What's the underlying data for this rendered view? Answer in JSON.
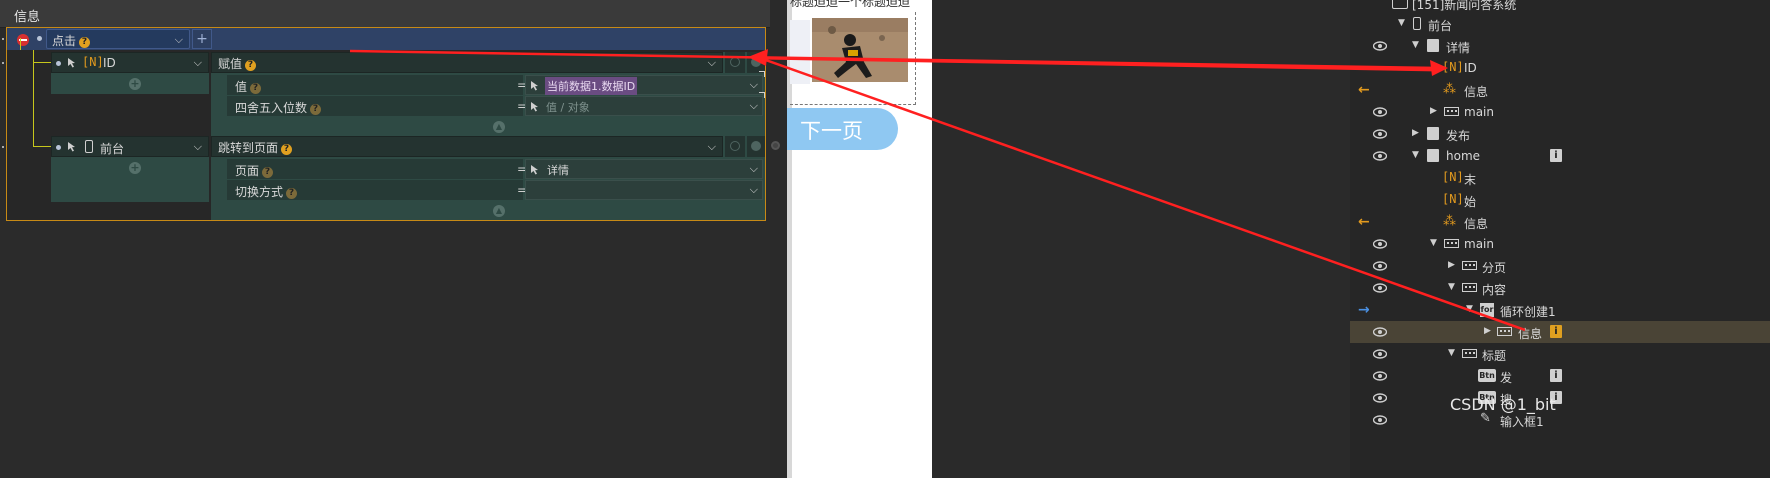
{
  "editor": {
    "title": "信息",
    "event_label": "点击",
    "actions": [
      {
        "target_label": "ID",
        "target_type": "[N]",
        "action_label": "赋值",
        "params": [
          {
            "name": "值",
            "value": "当前数据1.数据ID",
            "is_placeholder": false
          },
          {
            "name": "四舍五入位数",
            "value": "值 / 对象",
            "is_placeholder": true
          }
        ]
      },
      {
        "target_label": "前台",
        "action_label": "跳转到页面",
        "params": [
          {
            "name": "页面",
            "value": "详情",
            "is_placeholder": false
          },
          {
            "name": "切换方式",
            "value": "",
            "is_placeholder": false
          }
        ]
      }
    ],
    "equals": "="
  },
  "preview": {
    "top_text": "标题迫迫一个标题迫迫",
    "next_button": "下一页"
  },
  "tree": {
    "rows": [
      {
        "label": "[151]新闻问答系统",
        "indent": 60,
        "icon": "system-icon",
        "eye": false
      },
      {
        "label": "前台",
        "indent": 60,
        "icon": "phone-icon",
        "expanded": true,
        "eye": false
      },
      {
        "label": "详情",
        "indent": 78,
        "icon": "page-icon",
        "expanded": true,
        "eye": true
      },
      {
        "label": "ID",
        "indent": 96,
        "icon": "n-var-icon",
        "eye": false
      },
      {
        "label": "信息",
        "indent": 96,
        "icon": "event-icon",
        "eye": false,
        "arrow": "left"
      },
      {
        "label": "main",
        "indent": 96,
        "icon": "box-icon",
        "collapsed": true,
        "eye": true
      },
      {
        "label": "发布",
        "indent": 78,
        "icon": "page-icon",
        "collapsed": true,
        "eye": true
      },
      {
        "label": "home",
        "indent": 78,
        "icon": "page-icon",
        "expanded": true,
        "eye": true,
        "info": true
      },
      {
        "label": "末",
        "indent": 96,
        "icon": "n-var-icon",
        "eye": false
      },
      {
        "label": "始",
        "indent": 96,
        "icon": "n-var-icon",
        "eye": false
      },
      {
        "label": "信息",
        "indent": 96,
        "icon": "event-icon",
        "eye": false,
        "arrow": "left"
      },
      {
        "label": "main",
        "indent": 96,
        "icon": "box-icon",
        "expanded": true,
        "eye": true
      },
      {
        "label": "分页",
        "indent": 114,
        "icon": "box-icon",
        "collapsed": true,
        "eye": true
      },
      {
        "label": "内容",
        "indent": 114,
        "icon": "box-icon",
        "expanded": true,
        "eye": true
      },
      {
        "label": "循环创建1",
        "indent": 132,
        "icon": "for-icon",
        "expanded": true,
        "eye": false,
        "arrow": "right"
      },
      {
        "label": "信息",
        "indent": 150,
        "icon": "box-icon",
        "collapsed": true,
        "eye": true,
        "info": true,
        "warn": true,
        "highlight": true
      },
      {
        "label": "标题",
        "indent": 114,
        "icon": "box-icon",
        "expanded": true,
        "eye": true
      },
      {
        "label": "发",
        "indent": 132,
        "icon": "btn-icon",
        "eye": true,
        "info": true
      },
      {
        "label": "搜",
        "indent": 132,
        "icon": "btn-icon",
        "eye": true,
        "info": true
      },
      {
        "label": "输入框1",
        "indent": 132,
        "icon": "edit-icon",
        "eye": true
      }
    ]
  },
  "watermark": "CSDN @1_bit",
  "colors": {
    "accent": "#e0a020",
    "arrow": "#ff2020",
    "button": "#8fc8f2"
  }
}
